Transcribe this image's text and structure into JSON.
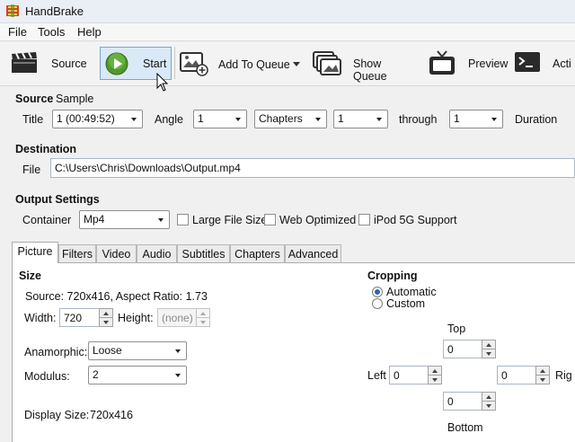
{
  "window": {
    "title": "HandBrake"
  },
  "menu": [
    "File",
    "Tools",
    "Help"
  ],
  "toolbar": {
    "source": "Source",
    "start": "Start",
    "add_to_queue": "Add To Queue",
    "show_queue": "Show Queue",
    "preview": "Preview",
    "activity": "Acti"
  },
  "source": {
    "label": "Source",
    "name": "Sample",
    "title_label": "Title",
    "title_value": "1 (00:49:52)",
    "angle_label": "Angle",
    "angle_value": "1",
    "range_mode": "Chapters",
    "range_start": "1",
    "through_label": "through",
    "range_end": "1",
    "duration_label": "Duration"
  },
  "destination": {
    "label": "Destination",
    "file_label": "File",
    "file_value": "C:\\Users\\Chris\\Downloads\\Output.mp4"
  },
  "output": {
    "label": "Output Settings",
    "container_label": "Container",
    "container_value": "Mp4",
    "large_file": "Large File Size",
    "web_optimized": "Web Optimized",
    "ipod": "iPod 5G Support"
  },
  "tabs": [
    "Picture",
    "Filters",
    "Video",
    "Audio",
    "Subtitles",
    "Chapters",
    "Advanced"
  ],
  "picture": {
    "size_label": "Size",
    "source_info": "Source:  720x416, Aspect Ratio: 1.73",
    "width_label": "Width:",
    "width_value": "720",
    "height_label": "Height:",
    "height_value": "(none)",
    "anamorphic_label": "Anamorphic:",
    "anamorphic_value": "Loose",
    "modulus_label": "Modulus:",
    "modulus_value": "2",
    "display_size_label": "Display Size:",
    "display_size_value": "720x416"
  },
  "cropping": {
    "label": "Cropping",
    "automatic": "Automatic",
    "custom": "Custom",
    "top_label": "Top",
    "top": "0",
    "left_label": "Left",
    "left": "0",
    "right_label": "Rig",
    "right": "0",
    "bottom_label": "Bottom",
    "bottom": "0"
  }
}
